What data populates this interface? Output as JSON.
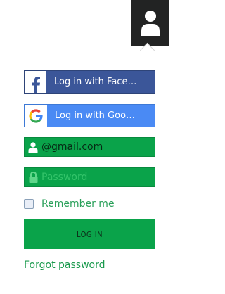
{
  "header": {
    "user_icon": "user-icon"
  },
  "login_panel": {
    "facebook_label": "Log in with Face…",
    "google_label": "Log in with Goo…",
    "email": {
      "value": "@gmail.com",
      "icon": "user-icon"
    },
    "password": {
      "placeholder": "Password",
      "icon": "lock-icon"
    },
    "remember_label": "Remember me",
    "login_label": "LOG IN",
    "forgot_label": "Forgot password"
  },
  "colors": {
    "header_bg": "#222323",
    "facebook": "#3b5699",
    "google": "#4a8af4",
    "green": "#0aa34a"
  }
}
